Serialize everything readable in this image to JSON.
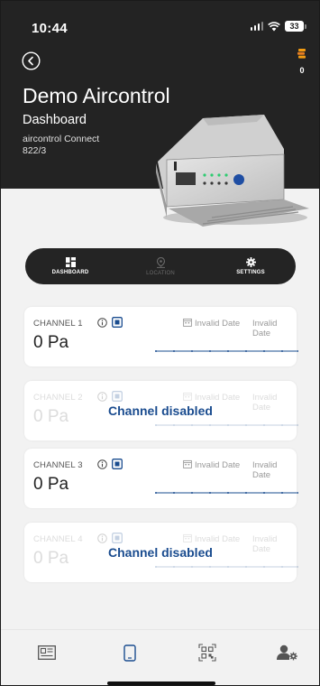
{
  "status": {
    "time": "10:44",
    "battery": "33"
  },
  "header": {
    "title": "Demo Aircontrol",
    "subtitle": "Dashboard",
    "device_name": "aircontrol Connect",
    "device_code": "822/3",
    "coins": "0"
  },
  "nav": {
    "items": [
      {
        "label": "DASHBOARD",
        "icon": "dashboard-icon",
        "active": true
      },
      {
        "label": "LOCATION",
        "icon": "location-pin-icon",
        "active": false
      },
      {
        "label": "SETTINGS",
        "icon": "gear-icon",
        "active": true
      }
    ]
  },
  "channels": [
    {
      "label": "CHANNEL 1",
      "value": "0 Pa",
      "date_from": "Invalid Date",
      "date_to": "Invalid Date",
      "enabled": true
    },
    {
      "label": "CHANNEL 2",
      "value": "0 Pa",
      "date_from": "Invalid Date",
      "date_to": "Invalid Date",
      "enabled": false,
      "disabled_text": "Channel disabled"
    },
    {
      "label": "CHANNEL 3",
      "value": "0 Pa",
      "date_from": "Invalid Date",
      "date_to": "Invalid Date",
      "enabled": true
    },
    {
      "label": "CHANNEL 4",
      "value": "0 Pa",
      "date_from": "Invalid Date",
      "date_to": "Invalid Date",
      "enabled": false,
      "disabled_text": "Channel disabled"
    }
  ],
  "bottom_tabs": [
    {
      "icon": "news-icon"
    },
    {
      "icon": "phone-device-icon"
    },
    {
      "icon": "qr-code-icon"
    },
    {
      "icon": "user-settings-icon"
    }
  ],
  "colors": {
    "accent": "#1a4c8f",
    "header_bg": "#232323",
    "nav_bg": "#242424"
  }
}
